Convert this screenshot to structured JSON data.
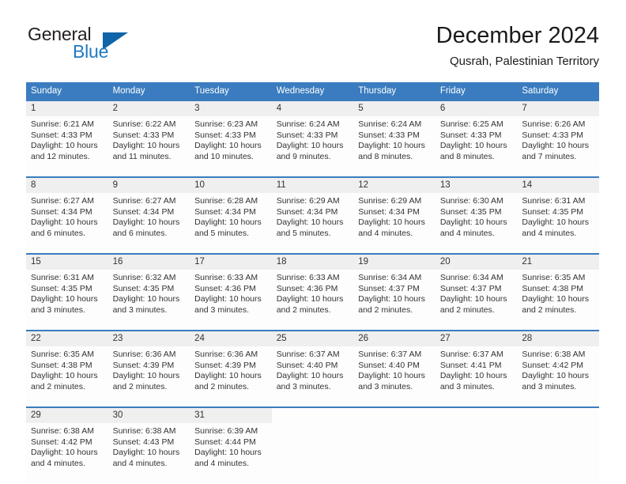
{
  "brand": {
    "name_part1": "General",
    "name_part2": "Blue",
    "logo_icon": "blue-triangle-logo"
  },
  "header": {
    "month_title": "December 2024",
    "location": "Qusrah, Palestinian Territory"
  },
  "colors": {
    "header_blue": "#3a7cbf",
    "brand_blue": "#1f7ac4",
    "logo_blue": "#1064a8",
    "daynum_background": "#efefef",
    "text": "#333333"
  },
  "calendar": {
    "weekday_headers": [
      "Sunday",
      "Monday",
      "Tuesday",
      "Wednesday",
      "Thursday",
      "Friday",
      "Saturday"
    ],
    "weeks": [
      [
        {
          "day": "1",
          "sunrise": "Sunrise: 6:21 AM",
          "sunset": "Sunset: 4:33 PM",
          "daylight_line1": "Daylight: 10 hours",
          "daylight_line2": "and 12 minutes."
        },
        {
          "day": "2",
          "sunrise": "Sunrise: 6:22 AM",
          "sunset": "Sunset: 4:33 PM",
          "daylight_line1": "Daylight: 10 hours",
          "daylight_line2": "and 11 minutes."
        },
        {
          "day": "3",
          "sunrise": "Sunrise: 6:23 AM",
          "sunset": "Sunset: 4:33 PM",
          "daylight_line1": "Daylight: 10 hours",
          "daylight_line2": "and 10 minutes."
        },
        {
          "day": "4",
          "sunrise": "Sunrise: 6:24 AM",
          "sunset": "Sunset: 4:33 PM",
          "daylight_line1": "Daylight: 10 hours",
          "daylight_line2": "and 9 minutes."
        },
        {
          "day": "5",
          "sunrise": "Sunrise: 6:24 AM",
          "sunset": "Sunset: 4:33 PM",
          "daylight_line1": "Daylight: 10 hours",
          "daylight_line2": "and 8 minutes."
        },
        {
          "day": "6",
          "sunrise": "Sunrise: 6:25 AM",
          "sunset": "Sunset: 4:33 PM",
          "daylight_line1": "Daylight: 10 hours",
          "daylight_line2": "and 8 minutes."
        },
        {
          "day": "7",
          "sunrise": "Sunrise: 6:26 AM",
          "sunset": "Sunset: 4:33 PM",
          "daylight_line1": "Daylight: 10 hours",
          "daylight_line2": "and 7 minutes."
        }
      ],
      [
        {
          "day": "8",
          "sunrise": "Sunrise: 6:27 AM",
          "sunset": "Sunset: 4:34 PM",
          "daylight_line1": "Daylight: 10 hours",
          "daylight_line2": "and 6 minutes."
        },
        {
          "day": "9",
          "sunrise": "Sunrise: 6:27 AM",
          "sunset": "Sunset: 4:34 PM",
          "daylight_line1": "Daylight: 10 hours",
          "daylight_line2": "and 6 minutes."
        },
        {
          "day": "10",
          "sunrise": "Sunrise: 6:28 AM",
          "sunset": "Sunset: 4:34 PM",
          "daylight_line1": "Daylight: 10 hours",
          "daylight_line2": "and 5 minutes."
        },
        {
          "day": "11",
          "sunrise": "Sunrise: 6:29 AM",
          "sunset": "Sunset: 4:34 PM",
          "daylight_line1": "Daylight: 10 hours",
          "daylight_line2": "and 5 minutes."
        },
        {
          "day": "12",
          "sunrise": "Sunrise: 6:29 AM",
          "sunset": "Sunset: 4:34 PM",
          "daylight_line1": "Daylight: 10 hours",
          "daylight_line2": "and 4 minutes."
        },
        {
          "day": "13",
          "sunrise": "Sunrise: 6:30 AM",
          "sunset": "Sunset: 4:35 PM",
          "daylight_line1": "Daylight: 10 hours",
          "daylight_line2": "and 4 minutes."
        },
        {
          "day": "14",
          "sunrise": "Sunrise: 6:31 AM",
          "sunset": "Sunset: 4:35 PM",
          "daylight_line1": "Daylight: 10 hours",
          "daylight_line2": "and 4 minutes."
        }
      ],
      [
        {
          "day": "15",
          "sunrise": "Sunrise: 6:31 AM",
          "sunset": "Sunset: 4:35 PM",
          "daylight_line1": "Daylight: 10 hours",
          "daylight_line2": "and 3 minutes."
        },
        {
          "day": "16",
          "sunrise": "Sunrise: 6:32 AM",
          "sunset": "Sunset: 4:35 PM",
          "daylight_line1": "Daylight: 10 hours",
          "daylight_line2": "and 3 minutes."
        },
        {
          "day": "17",
          "sunrise": "Sunrise: 6:33 AM",
          "sunset": "Sunset: 4:36 PM",
          "daylight_line1": "Daylight: 10 hours",
          "daylight_line2": "and 3 minutes."
        },
        {
          "day": "18",
          "sunrise": "Sunrise: 6:33 AM",
          "sunset": "Sunset: 4:36 PM",
          "daylight_line1": "Daylight: 10 hours",
          "daylight_line2": "and 2 minutes."
        },
        {
          "day": "19",
          "sunrise": "Sunrise: 6:34 AM",
          "sunset": "Sunset: 4:37 PM",
          "daylight_line1": "Daylight: 10 hours",
          "daylight_line2": "and 2 minutes."
        },
        {
          "day": "20",
          "sunrise": "Sunrise: 6:34 AM",
          "sunset": "Sunset: 4:37 PM",
          "daylight_line1": "Daylight: 10 hours",
          "daylight_line2": "and 2 minutes."
        },
        {
          "day": "21",
          "sunrise": "Sunrise: 6:35 AM",
          "sunset": "Sunset: 4:38 PM",
          "daylight_line1": "Daylight: 10 hours",
          "daylight_line2": "and 2 minutes."
        }
      ],
      [
        {
          "day": "22",
          "sunrise": "Sunrise: 6:35 AM",
          "sunset": "Sunset: 4:38 PM",
          "daylight_line1": "Daylight: 10 hours",
          "daylight_line2": "and 2 minutes."
        },
        {
          "day": "23",
          "sunrise": "Sunrise: 6:36 AM",
          "sunset": "Sunset: 4:39 PM",
          "daylight_line1": "Daylight: 10 hours",
          "daylight_line2": "and 2 minutes."
        },
        {
          "day": "24",
          "sunrise": "Sunrise: 6:36 AM",
          "sunset": "Sunset: 4:39 PM",
          "daylight_line1": "Daylight: 10 hours",
          "daylight_line2": "and 2 minutes."
        },
        {
          "day": "25",
          "sunrise": "Sunrise: 6:37 AM",
          "sunset": "Sunset: 4:40 PM",
          "daylight_line1": "Daylight: 10 hours",
          "daylight_line2": "and 3 minutes."
        },
        {
          "day": "26",
          "sunrise": "Sunrise: 6:37 AM",
          "sunset": "Sunset: 4:40 PM",
          "daylight_line1": "Daylight: 10 hours",
          "daylight_line2": "and 3 minutes."
        },
        {
          "day": "27",
          "sunrise": "Sunrise: 6:37 AM",
          "sunset": "Sunset: 4:41 PM",
          "daylight_line1": "Daylight: 10 hours",
          "daylight_line2": "and 3 minutes."
        },
        {
          "day": "28",
          "sunrise": "Sunrise: 6:38 AM",
          "sunset": "Sunset: 4:42 PM",
          "daylight_line1": "Daylight: 10 hours",
          "daylight_line2": "and 3 minutes."
        }
      ],
      [
        {
          "day": "29",
          "sunrise": "Sunrise: 6:38 AM",
          "sunset": "Sunset: 4:42 PM",
          "daylight_line1": "Daylight: 10 hours",
          "daylight_line2": "and 4 minutes."
        },
        {
          "day": "30",
          "sunrise": "Sunrise: 6:38 AM",
          "sunset": "Sunset: 4:43 PM",
          "daylight_line1": "Daylight: 10 hours",
          "daylight_line2": "and 4 minutes."
        },
        {
          "day": "31",
          "sunrise": "Sunrise: 6:39 AM",
          "sunset": "Sunset: 4:44 PM",
          "daylight_line1": "Daylight: 10 hours",
          "daylight_line2": "and 4 minutes."
        },
        {
          "day": "",
          "sunrise": "",
          "sunset": "",
          "daylight_line1": "",
          "daylight_line2": ""
        },
        {
          "day": "",
          "sunrise": "",
          "sunset": "",
          "daylight_line1": "",
          "daylight_line2": ""
        },
        {
          "day": "",
          "sunrise": "",
          "sunset": "",
          "daylight_line1": "",
          "daylight_line2": ""
        },
        {
          "day": "",
          "sunrise": "",
          "sunset": "",
          "daylight_line1": "",
          "daylight_line2": ""
        }
      ]
    ]
  }
}
